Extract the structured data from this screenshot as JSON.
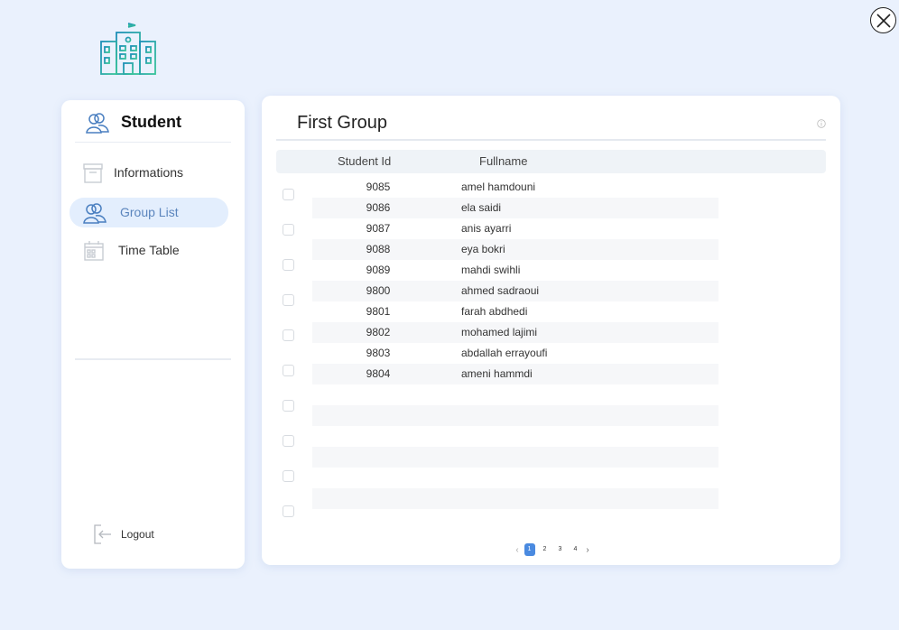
{
  "window": {
    "close_label": "close"
  },
  "sidebar": {
    "header": "Student",
    "items": [
      {
        "label": "Informations",
        "icon": "archive-icon",
        "active": false
      },
      {
        "label": "Group List",
        "icon": "users-icon",
        "active": true
      },
      {
        "label": "Time Table",
        "icon": "calendar-icon",
        "active": false
      }
    ],
    "logout_label": "Logout"
  },
  "main": {
    "title": "First Group",
    "columns": [
      "Student Id",
      "Fullname"
    ],
    "rows": [
      {
        "id": "9085",
        "name": "amel hamdouni"
      },
      {
        "id": "9086",
        "name": "ela saidi"
      },
      {
        "id": "9087",
        "name": "anis ayarri"
      },
      {
        "id": "9088",
        "name": "eya bokri"
      },
      {
        "id": "9089",
        "name": "mahdi swihli"
      },
      {
        "id": "9800",
        "name": "ahmed sadraoui"
      },
      {
        "id": "9801",
        "name": "farah abdhedi"
      },
      {
        "id": "9802",
        "name": "mohamed lajimi"
      },
      {
        "id": "9803",
        "name": "abdallah errayoufi"
      },
      {
        "id": "9804",
        "name": "ameni hammdi"
      }
    ],
    "pagination": {
      "pages": [
        "1",
        "2",
        "3",
        "4"
      ],
      "current": "1",
      "prev": "‹",
      "next": "›"
    }
  },
  "colors": {
    "accent": "#4a8ae0",
    "active_bg": "#e3eefd",
    "background": "#eaf1fd",
    "logo": "#2fa6a0"
  }
}
